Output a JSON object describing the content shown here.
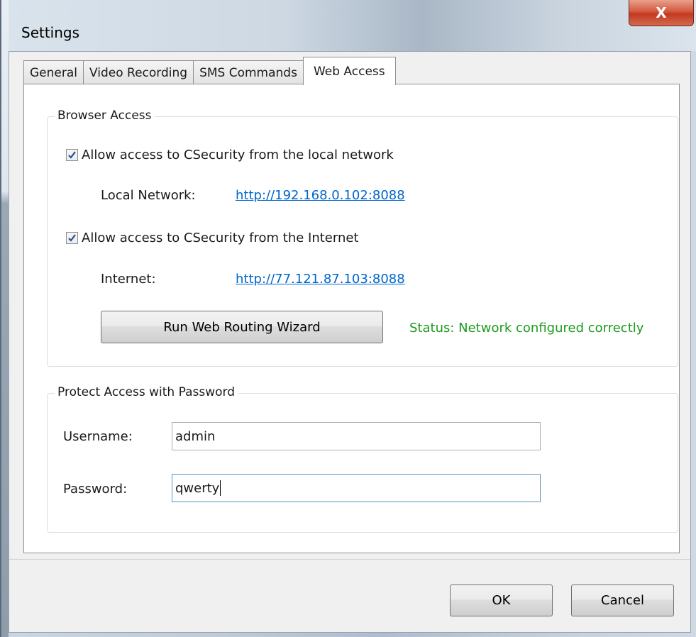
{
  "window": {
    "title": "Settings",
    "close_label": "X"
  },
  "tabs": [
    {
      "label": "General"
    },
    {
      "label": "Video Recording"
    },
    {
      "label": "SMS Commands"
    },
    {
      "label": "Web Access",
      "active": true
    }
  ],
  "browser_access": {
    "legend": "Browser Access",
    "local_checkbox": {
      "label": "Allow access to CSecurity from the local network",
      "checked": true
    },
    "local_label": "Local Network:",
    "local_url": "http://192.168.0.102:8088",
    "internet_checkbox": {
      "label": "Allow access to CSecurity from the Internet",
      "checked": true
    },
    "internet_label": "Internet:",
    "internet_url": "http://77.121.87.103:8088",
    "wizard_button": "Run Web Routing Wizard",
    "status": "Status: Network configured correctly",
    "status_color": "#1d9a1d"
  },
  "password_protect": {
    "legend": "Protect Access with Password",
    "username_label": "Username:",
    "username_value": "admin",
    "password_label": "Password:",
    "password_value": "qwerty"
  },
  "footer": {
    "ok_label": "OK",
    "cancel_label": "Cancel"
  }
}
